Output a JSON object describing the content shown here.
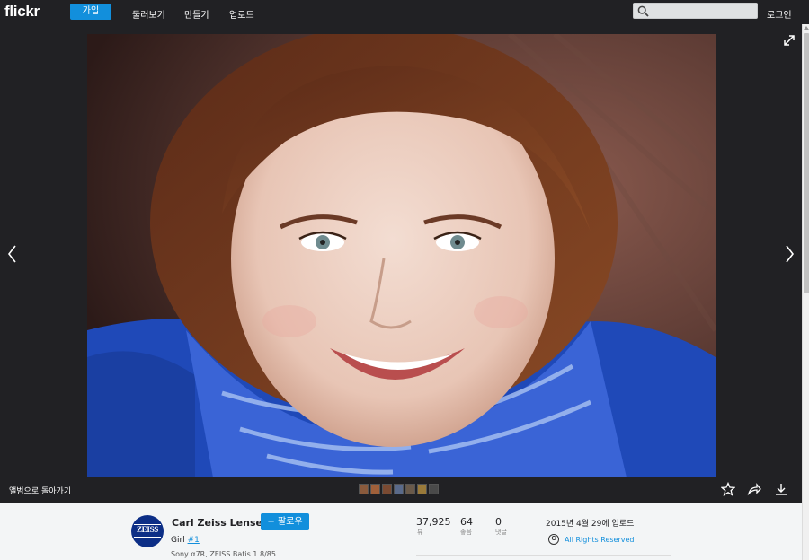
{
  "nav": {
    "logo": "flickr",
    "signup_label": "가입",
    "links": [
      "둘러보기",
      "만들기",
      "업로드"
    ],
    "search_placeholder": "",
    "login_label": "로그인"
  },
  "viewer": {
    "back_to_album": "앨범으로 돌아가기",
    "filmstrip_count": 7
  },
  "photo_info": {
    "owner": "Carl Zeiss Lenses",
    "follow_label": "+ 팔로우",
    "avatar_text": "ZEISS",
    "title": "Girl",
    "title_tag": "#1",
    "camera": "Sony α7R, ZEISS Batis 1.8/85",
    "stats": [
      {
        "value": "37,925",
        "label": "뷰"
      },
      {
        "value": "64",
        "label": "좋음"
      },
      {
        "value": "0",
        "label": "댓글"
      }
    ],
    "upload_date": "2015년 4월 29에 업로드",
    "rights_symbol": "C",
    "rights": "All Rights Reserved"
  },
  "colors": {
    "nav_bg": "#212124",
    "accent": "#128fdc",
    "info_bg": "#f3f5f6"
  }
}
